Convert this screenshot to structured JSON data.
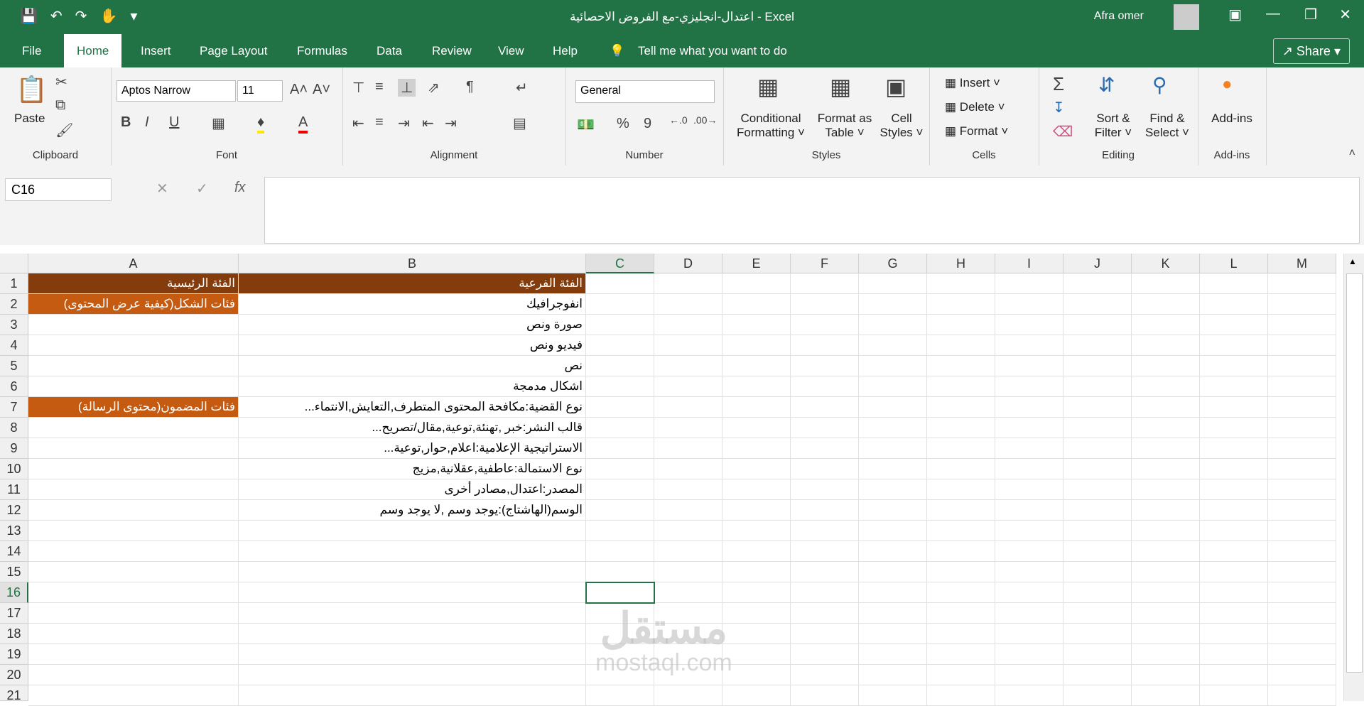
{
  "window": {
    "title": "اعتدال-انجليزي-مع الفروض الاحصائية  -  Excel",
    "user": "Afra omer",
    "undo_icon": "undo-icon",
    "redo_icon": "redo-icon",
    "save_icon": "save-icon"
  },
  "menu": {
    "tabs": [
      "File",
      "Home",
      "Insert",
      "Page Layout",
      "Formulas",
      "Data",
      "Review",
      "View",
      "Help"
    ],
    "tell_me": "Tell me what you want to do",
    "share": "Share"
  },
  "ribbon": {
    "clipboard": {
      "paste": "Paste",
      "label": "Clipboard"
    },
    "font": {
      "name": "Aptos Narrow",
      "size": "11",
      "bold": "B",
      "italic": "I",
      "underline": "U",
      "color_letter": "A",
      "label": "Font"
    },
    "alignment": {
      "label": "Alignment"
    },
    "number": {
      "format": "General",
      "percent": "%",
      "comma": "9",
      "label": "Number"
    },
    "styles": {
      "conditional": "Conditional",
      "conditional2": "Formatting",
      "format_as": "Format as",
      "format_as2": "Table",
      "cell": "Cell",
      "cell2": "Styles",
      "label": "Styles"
    },
    "cells": {
      "insert": "Insert",
      "delete": "Delete",
      "format": "Format",
      "label": "Cells"
    },
    "editing": {
      "sort": "Sort &",
      "sort2": "Filter",
      "find": "Find &",
      "find2": "Select",
      "label": "Editing"
    },
    "addins": {
      "addins": "Add-ins",
      "label": "Add-ins"
    }
  },
  "formula_bar": {
    "name_box": "C16",
    "fx": "fx",
    "value": ""
  },
  "columns": [
    "A",
    "B",
    "C",
    "D",
    "E",
    "F",
    "G",
    "H",
    "I",
    "J",
    "K",
    "L",
    "M"
  ],
  "rows": [
    "1",
    "2",
    "3",
    "4",
    "5",
    "6",
    "7",
    "8",
    "9",
    "10",
    "11",
    "12",
    "13",
    "14",
    "15",
    "16",
    "17",
    "18",
    "19",
    "20",
    "21"
  ],
  "cells": {
    "A1": "الفئة الرئيسية",
    "B1": "الفئة الفرعية",
    "A2": "فئات الشكل(كيفية عرض المحتوى)",
    "B2": "انفوجرافيك",
    "B3": "صورة ونص",
    "B4": "فيديو ونص",
    "B5": "نص",
    "B6": "اشكال مدمجة",
    "A7": "فئات المضمون(محتوى الرسالة)",
    "B7": "نوع القضية:مكافحة المحتوى المتطرف,التعايش,الانتماء...",
    "B8": "قالب النشر:خبر ,تهنئة,توعية,مقال/تصريح...",
    "B9": "الاستراتيجية الإعلامية:اعلام,حوار,توعية...",
    "B10": "نوع الاستمالة:عاطفية,عقلانية,مزيج",
    "B11": "المصدر:اعتدال,مصادر أخرى",
    "B12": "الوسم(الهاشتاج):يوجد وسم ,لا يوجد وسم"
  },
  "selected_cell": "C16",
  "watermark": {
    "line1": "مستقل",
    "line2": "mostaql.com"
  },
  "colors": {
    "excel_green": "#217346",
    "header_brown": "#843c0c",
    "category_orange": "#c55a11"
  }
}
